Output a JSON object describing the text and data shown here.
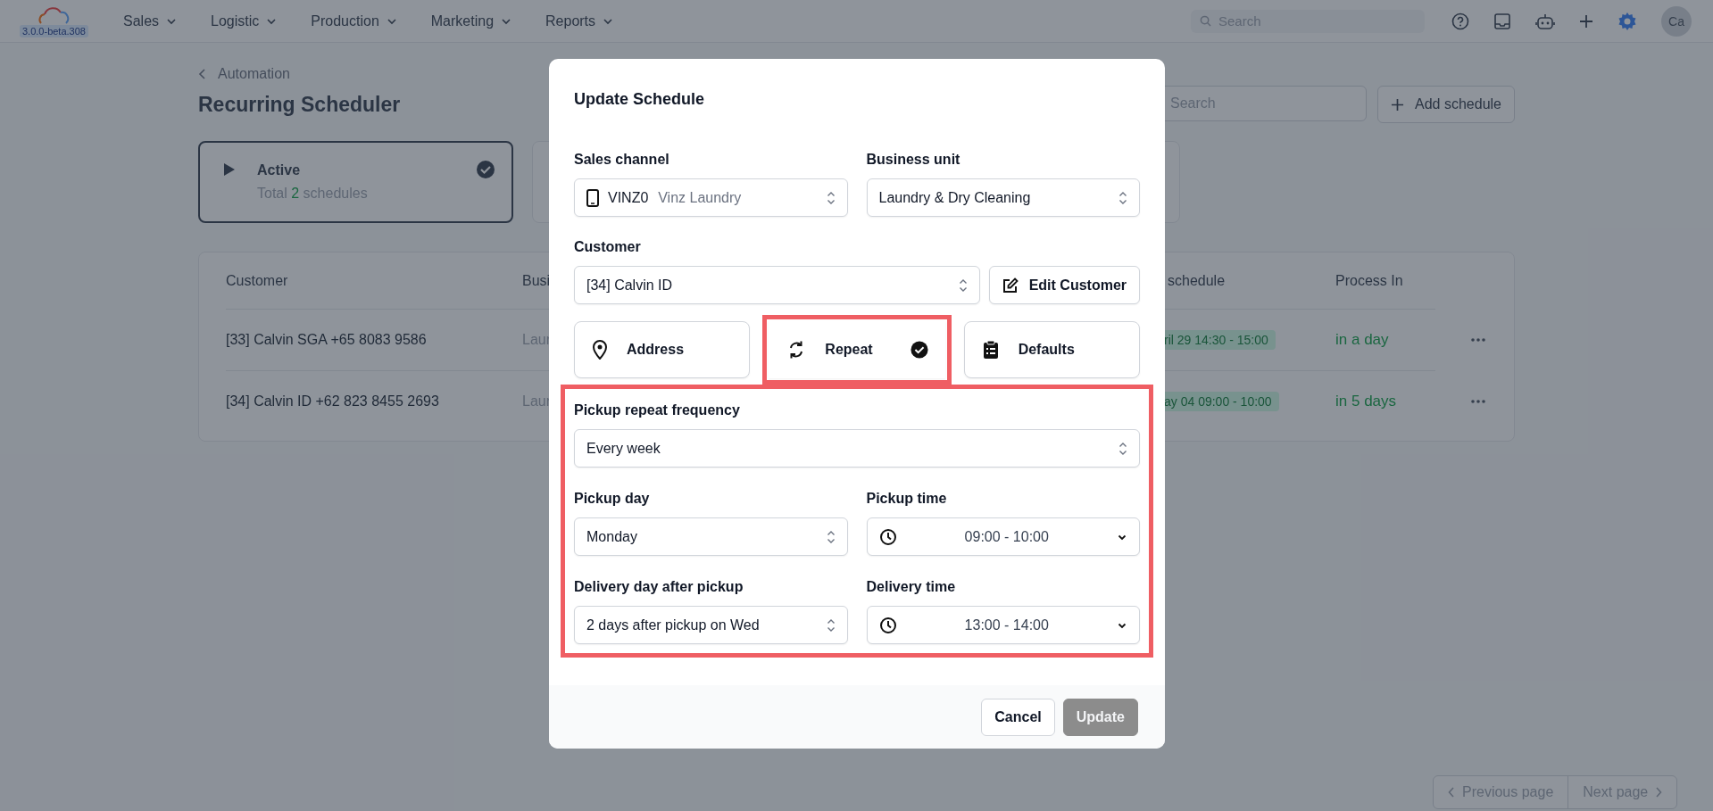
{
  "topbar": {
    "version": "3.0.0-beta.308",
    "menu": [
      {
        "label": "Sales"
      },
      {
        "label": "Logistic"
      },
      {
        "label": "Production"
      },
      {
        "label": "Marketing"
      },
      {
        "label": "Reports"
      }
    ],
    "search": {
      "placeholder": "Search"
    },
    "avatar": "Ca"
  },
  "page": {
    "breadcrumb": "Automation",
    "title": "Recurring Scheduler",
    "search": {
      "placeholder": "Search"
    },
    "add_button": "Add schedule",
    "status_cards": [
      {
        "title": "Active",
        "total_prefix": "Total",
        "count": "2",
        "total_suffix": "schedules",
        "selected": true
      }
    ],
    "table": {
      "columns": [
        "Customer",
        "Busi",
        "schedule",
        "Process In"
      ],
      "rows": [
        {
          "customer": "[33] Calvin SGA +65 8083 9586",
          "business": "Laur",
          "schedule": "ril 29 14:30 - 15:00",
          "process_in": "in a day"
        },
        {
          "customer": "[34] Calvin ID +62 823 8455 2693",
          "business": "Laur",
          "schedule": "ay 04 09:00 - 10:00",
          "process_in": "in 5 days"
        }
      ]
    },
    "pagination": {
      "previous": "Previous page",
      "next": "Next page"
    }
  },
  "modal": {
    "title": "Update Schedule",
    "sales_channel": {
      "label": "Sales channel",
      "code": "VINZ0",
      "name": "Vinz Laundry"
    },
    "business_unit": {
      "label": "Business unit",
      "value": "Laundry & Dry Cleaning"
    },
    "customer": {
      "label": "Customer",
      "value": "[34] Calvin ID",
      "edit_button": "Edit Customer"
    },
    "tabs": [
      {
        "kind": "address",
        "label": "Address",
        "selected": false,
        "highlighted": false
      },
      {
        "kind": "repeat",
        "label": "Repeat",
        "selected": true,
        "highlighted": true
      },
      {
        "kind": "defaults",
        "label": "Defaults",
        "selected": false,
        "highlighted": false
      }
    ],
    "repeat_settings": {
      "highlighted": true,
      "frequency": {
        "label": "Pickup repeat frequency",
        "value": "Every week"
      },
      "pickup_day": {
        "label": "Pickup day",
        "value": "Monday"
      },
      "pickup_time": {
        "label": "Pickup time",
        "value": "09:00 - 10:00"
      },
      "delivery_day": {
        "label": "Delivery day after pickup",
        "value": "2 days after pickup on Wed"
      },
      "delivery_time": {
        "label": "Delivery time",
        "value": "13:00 - 14:00"
      }
    },
    "buttons": [
      {
        "label": "Cancel",
        "kind": "secondary"
      },
      {
        "label": "Update",
        "kind": "primary",
        "disabled": true
      }
    ]
  }
}
